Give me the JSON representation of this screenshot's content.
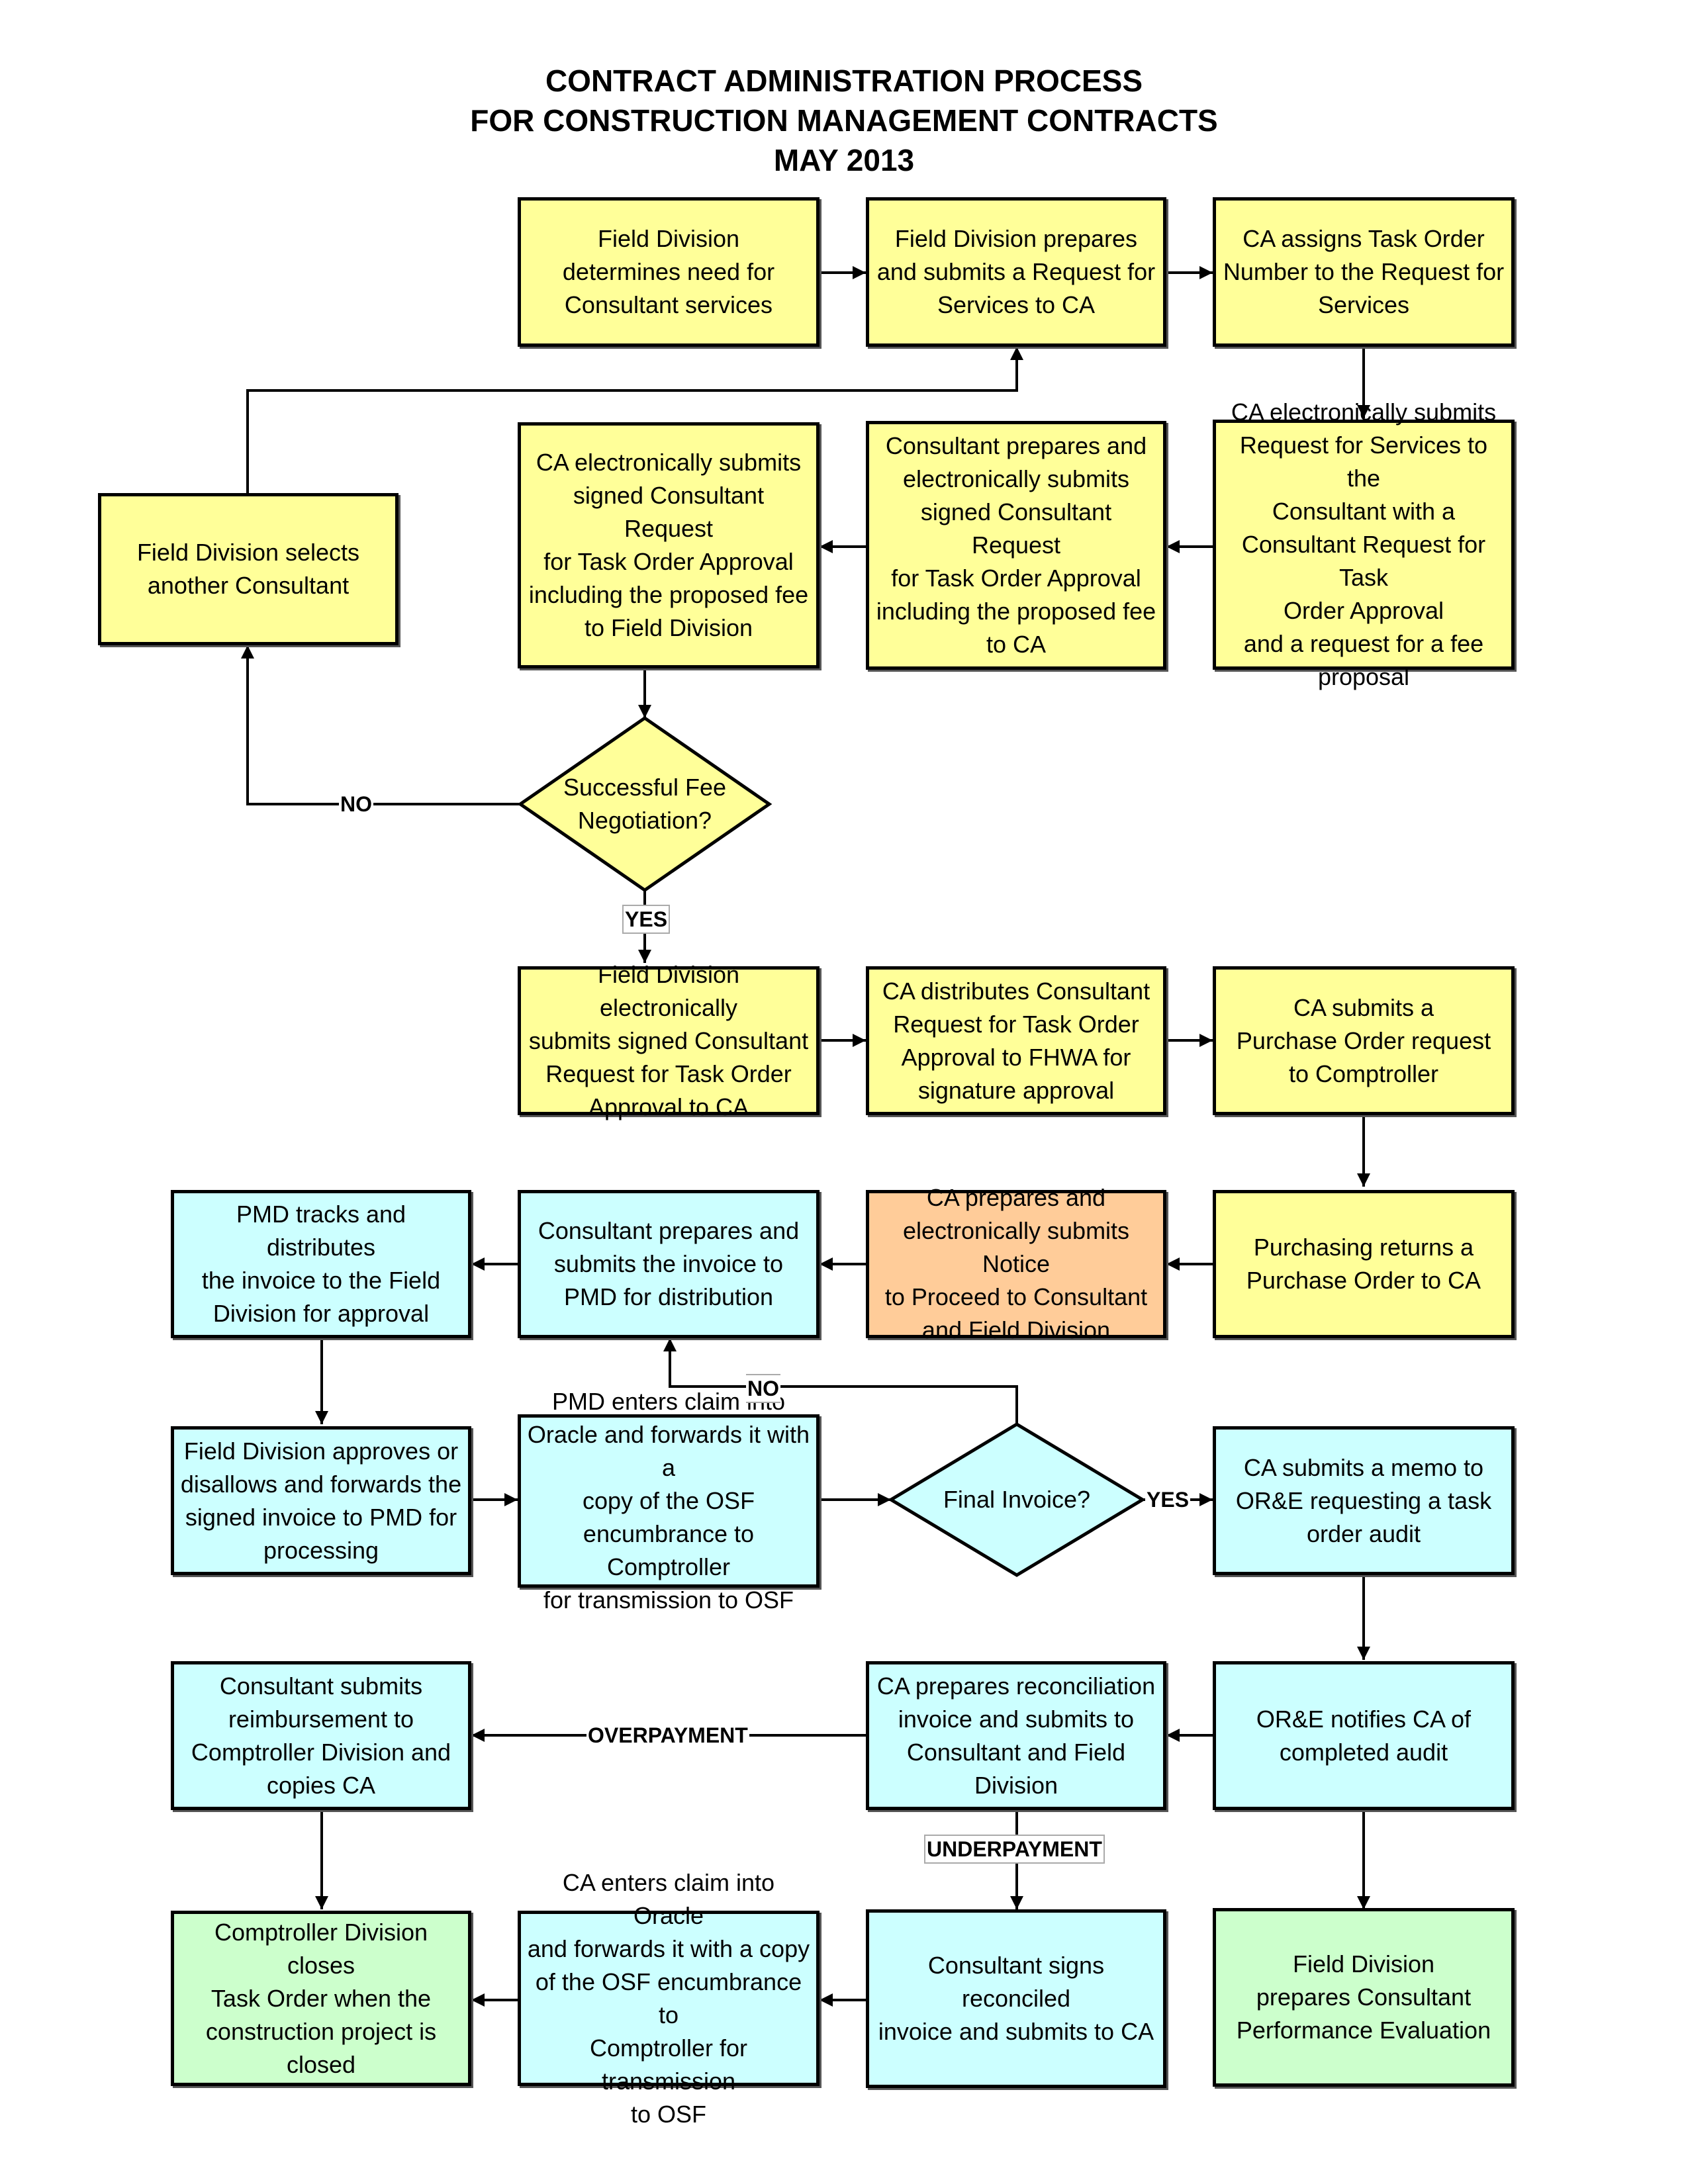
{
  "title": {
    "line1": "CONTRACT ADMINISTRATION PROCESS",
    "line2": "FOR CONSTRUCTION MANAGEMENT CONTRACTS",
    "line3": "MAY 2013"
  },
  "colors": {
    "yellow": "#ffff99",
    "cyan": "#ccffff",
    "orange": "#ffcc99",
    "green": "#ccffcc"
  },
  "steps": {
    "determine_need": "Field Division\ndetermines need for\nConsultant services",
    "prepare_request": "Field Division prepares\nand submits a Request for\nServices to CA",
    "assign_number": "CA assigns Task Order\nNumber to the Request for\nServices",
    "ca_submits_rfs": "CA electronically submits\nRequest for Services to the\nConsultant with a\nConsultant Request for Task\nOrder Approval\nand a request for a fee\nproposal",
    "consultant_prepares_fee": "Consultant prepares and\nelectronically submits\nsigned Consultant Request\nfor Task Order Approval\nincluding the proposed fee\nto CA",
    "ca_submits_to_fd": "CA electronically submits\nsigned Consultant Request\nfor Task Order Approval\nincluding the proposed fee\nto Field Division",
    "select_another": "Field Division selects\nanother Consultant",
    "fd_submits_signed": "Field Division electronically\nsubmits signed Consultant\nRequest for Task Order\nApproval to CA",
    "ca_distributes_fhwa": "CA distributes Consultant\nRequest for Task Order\nApproval to FHWA for\nsignature approval",
    "ca_po_request": "CA submits a\nPurchase Order request\nto Comptroller",
    "purchasing_returns": "Purchasing returns a\nPurchase Order to CA",
    "notice_to_proceed": "CA prepares and\nelectronically submits Notice\nto Proceed to Consultant\nand Field Division",
    "consultant_invoice": "Consultant prepares and\nsubmits the invoice to\nPMD for distribution",
    "pmd_tracks": "PMD tracks and distributes\nthe invoice to the Field\nDivision for approval",
    "fd_approves": "Field Division approves or\ndisallows and forwards the\nsigned invoice to PMD for\nprocessing",
    "pmd_enters_claim": "PMD enters claim into\nOracle and forwards it with a\ncopy of the OSF\nencumbrance to Comptroller\nfor transmission to OSF",
    "memo_audit": "CA submits a memo to\nOR&E requesting  a task\norder audit",
    "ore_notifies": "OR&E notifies CA of\ncompleted audit",
    "reconciliation": "CA prepares reconciliation\ninvoice and submits to\nConsultant and Field\nDivision",
    "reimbursement": "Consultant submits\nreimbursement to\nComptroller Division and\ncopies CA",
    "comptroller_closes": "Comptroller Division closes\nTask Order when the\nconstruction project is\nclosed",
    "ca_enters_claim": "CA enters claim into Oracle\nand forwards it with a copy\nof the OSF encumbrance to\nComptroller for transmission\nto OSF",
    "consultant_signs": "Consultant signs reconciled\ninvoice and submits to CA",
    "performance_eval": "Field Division\nprepares Consultant\nPerformance Evaluation"
  },
  "decisions": {
    "fee_negotiation": "Successful Fee\nNegotiation?",
    "final_invoice": "Final Invoice?"
  },
  "edge_labels": {
    "fee_no": "NO",
    "fee_yes": "YES",
    "invoice_no": "NO",
    "invoice_yes": "YES",
    "overpayment": "OVERPAYMENT",
    "underpayment": "UNDERPAYMENT"
  }
}
